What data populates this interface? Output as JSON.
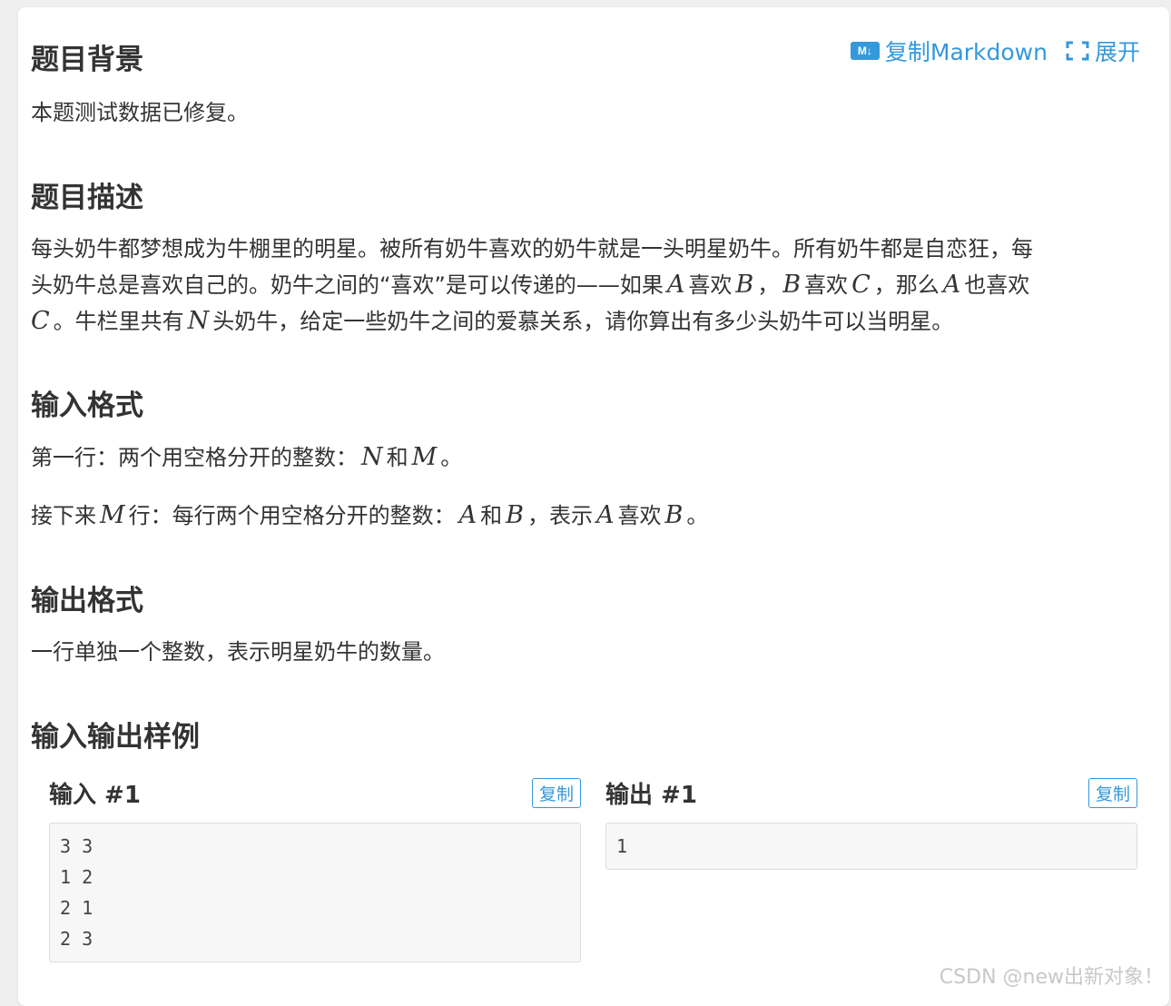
{
  "toolbar": {
    "copy_markdown_icon": "markdown-icon",
    "copy_markdown_label": "复制Markdown",
    "expand_icon": "expand-icon",
    "expand_label": "展开"
  },
  "background": {
    "title": "题目背景",
    "text": "本题测试数据已修复。"
  },
  "description": {
    "title": "题目描述",
    "line1": "每头奶牛都梦想成为牛棚里的明星。被所有奶牛喜欢的奶牛就是一头明星奶牛。所有奶牛都是自恋狂，每",
    "line2_a": "头奶牛总是喜欢自己的。奶牛之间的“喜欢”是可以传递的——如果",
    "var_A": "A",
    "like": "喜欢",
    "var_B": "B",
    "comma": "，",
    "var_C": "C",
    "line2_b": "，那么",
    "line2_c": "也喜欢",
    "line3_a": "。牛栏里共有",
    "var_N": "N",
    "line3_b": "头奶牛，给定一些奶牛之间的爱慕关系，请你算出有多少头奶牛可以当明星。"
  },
  "input_format": {
    "title": "输入格式",
    "l1_a": "第一行：两个用空格分开的整数：",
    "var_N": "N",
    "and": "和",
    "var_M": "M",
    "period": "。",
    "l2_a": "接下来",
    "l2_b": "行：每行两个用空格分开的整数：",
    "var_A": "A",
    "var_B": "B",
    "l2_c": "，表示",
    "like": "喜欢"
  },
  "output_format": {
    "title": "输出格式",
    "text": "一行单独一个整数，表示明星奶牛的数量。"
  },
  "samples": {
    "title": "输入输出样例",
    "input_title": "输入 #1",
    "output_title": "输出 #1",
    "copy_label": "复制",
    "input_data": "3 3\n1 2\n2 1\n2 3",
    "output_data": "1"
  },
  "watermark": "CSDN @new出新对象！",
  "colors": {
    "accent": "#3498db",
    "text": "#333333",
    "background": "#efefef"
  }
}
